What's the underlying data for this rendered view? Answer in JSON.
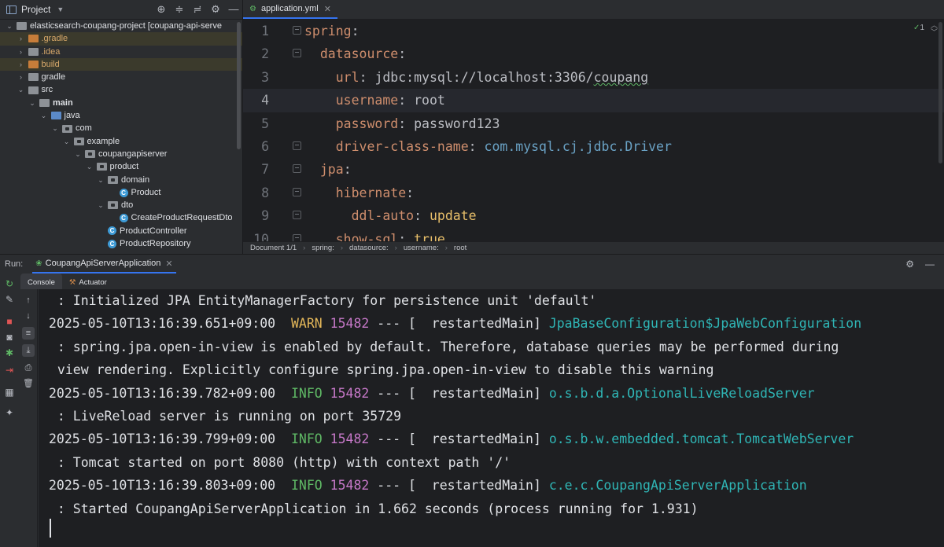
{
  "project": {
    "title": "Project",
    "tree": [
      {
        "indent": 0,
        "chev": "⌄",
        "icon": "proj",
        "label": "elasticsearch-coupang-project [coupang-api-serve",
        "bold_part": "",
        "hl": false
      },
      {
        "indent": 1,
        "chev": "›",
        "icon": "orange",
        "label": ".gradle",
        "hl": true,
        "orange": true
      },
      {
        "indent": 1,
        "chev": "›",
        "icon": "gray",
        "label": ".idea",
        "hl": false,
        "orange": true
      },
      {
        "indent": 1,
        "chev": "›",
        "icon": "orange",
        "label": "build",
        "hl": true,
        "orange": true
      },
      {
        "indent": 1,
        "chev": "›",
        "icon": "gray",
        "label": "gradle",
        "hl": false
      },
      {
        "indent": 1,
        "chev": "⌄",
        "icon": "gray",
        "label": "src",
        "hl": false
      },
      {
        "indent": 2,
        "chev": "⌄",
        "icon": "gray",
        "label": "main",
        "hl": false,
        "bold": true
      },
      {
        "indent": 3,
        "chev": "⌄",
        "icon": "blue",
        "label": "java",
        "hl": false
      },
      {
        "indent": 4,
        "chev": "⌄",
        "icon": "pkg",
        "label": "com",
        "hl": false
      },
      {
        "indent": 5,
        "chev": "⌄",
        "icon": "pkg",
        "label": "example",
        "hl": false
      },
      {
        "indent": 6,
        "chev": "⌄",
        "icon": "pkg",
        "label": "coupangapiserver",
        "hl": false
      },
      {
        "indent": 7,
        "chev": "⌄",
        "icon": "pkg",
        "label": "product",
        "hl": false
      },
      {
        "indent": 8,
        "chev": "⌄",
        "icon": "pkg",
        "label": "domain",
        "hl": false
      },
      {
        "indent": 9,
        "chev": "",
        "icon": "class",
        "label": "Product",
        "hl": false
      },
      {
        "indent": 8,
        "chev": "⌄",
        "icon": "pkg",
        "label": "dto",
        "hl": false
      },
      {
        "indent": 9,
        "chev": "",
        "icon": "class",
        "label": "CreateProductRequestDto",
        "hl": false
      },
      {
        "indent": 8,
        "chev": "",
        "icon": "class",
        "label": "ProductController",
        "hl": false
      },
      {
        "indent": 8,
        "chev": "",
        "icon": "class",
        "label": "ProductRepository",
        "hl": false
      }
    ]
  },
  "editor": {
    "tab_label": "application.yml",
    "status": "1",
    "lines": [
      {
        "n": "1",
        "indent": "",
        "key": "spring",
        "value": "",
        "vclass": "",
        "fold": true,
        "current": false
      },
      {
        "n": "2",
        "indent": "  ",
        "key": "datasource",
        "value": "",
        "vclass": "",
        "fold": true,
        "current": false
      },
      {
        "n": "3",
        "indent": "    ",
        "key": "url",
        "value": "jdbc:mysql://localhost:3306/coupang",
        "vclass": "v",
        "squig": "coupang",
        "fold": false,
        "current": false
      },
      {
        "n": "4",
        "indent": "    ",
        "key": "username",
        "value": "root",
        "vclass": "v",
        "fold": false,
        "current": true
      },
      {
        "n": "5",
        "indent": "    ",
        "key": "password",
        "value": "password123",
        "vclass": "v",
        "fold": false,
        "current": false
      },
      {
        "n": "6",
        "indent": "    ",
        "key": "driver-class-name",
        "value": "com.mysql.cj.jdbc.Driver",
        "vclass": "vc",
        "fold": true,
        "current": false
      },
      {
        "n": "7",
        "indent": "  ",
        "key": "jpa",
        "value": "",
        "vclass": "",
        "fold": true,
        "current": false
      },
      {
        "n": "8",
        "indent": "    ",
        "key": "hibernate",
        "value": "",
        "vclass": "",
        "fold": true,
        "current": false
      },
      {
        "n": "9",
        "indent": "      ",
        "key": "ddl-auto",
        "value": "update",
        "vclass": "vy",
        "fold": true,
        "current": false
      },
      {
        "n": "10",
        "indent": "    ",
        "key": "show-sql",
        "value": "true",
        "vclass": "vy",
        "fold": true,
        "current": false
      }
    ],
    "breadcrumb": [
      "Document 1/1",
      "spring:",
      "datasource:",
      "username:",
      "root"
    ]
  },
  "run": {
    "label": "Run:",
    "tab_label": "CoupangApiServerApplication",
    "subtabs": {
      "console": "Console",
      "actuator": "Actuator"
    },
    "console_lines": [
      {
        "kind": "msg",
        "text": " : Initialized JPA EntityManagerFactory for persistence unit 'default'"
      },
      {
        "kind": "log",
        "ts": "2025-05-10T13:16:39.651+09:00",
        "level": "WARN",
        "pid": "15482",
        "mid": " --- [  restartedMain] ",
        "logger": "JpaBaseConfiguration$JpaWebConfiguration"
      },
      {
        "kind": "msg",
        "text": " : spring.jpa.open-in-view is enabled by default. Therefore, database queries may be performed during"
      },
      {
        "kind": "msg",
        "text": " view rendering. Explicitly configure spring.jpa.open-in-view to disable this warning"
      },
      {
        "kind": "log",
        "ts": "2025-05-10T13:16:39.782+09:00",
        "level": "INFO",
        "pid": "15482",
        "mid": " --- [  restartedMain] ",
        "logger": "o.s.b.d.a.OptionalLiveReloadServer"
      },
      {
        "kind": "msg",
        "text": " : LiveReload server is running on port 35729"
      },
      {
        "kind": "log",
        "ts": "2025-05-10T13:16:39.799+09:00",
        "level": "INFO",
        "pid": "15482",
        "mid": " --- [  restartedMain] ",
        "logger": "o.s.b.w.embedded.tomcat.TomcatWebServer"
      },
      {
        "kind": "msg",
        "text": " : Tomcat started on port 8080 (http) with context path '/'"
      },
      {
        "kind": "log",
        "ts": "2025-05-10T13:16:39.803+09:00",
        "level": "INFO",
        "pid": "15482",
        "mid": " --- [  restartedMain] ",
        "logger": "c.e.c.CoupangApiServerApplication"
      },
      {
        "kind": "msg",
        "text": " : Started CoupangApiServerApplication in 1.662 seconds (process running for 1.931)"
      }
    ]
  },
  "icons": {
    "project_tools": [
      "crosshair-icon",
      "collapse-icon",
      "expand-icon",
      "gear-icon",
      "minimize-icon"
    ],
    "run_tools": [
      "gear-icon",
      "minimize-icon"
    ]
  },
  "colors": {
    "accent": "#3574f0",
    "warn": "#e2b659",
    "info": "#5fb865",
    "pid": "#c678c8",
    "logger": "#2fb5b5",
    "yaml_key": "#cf8e6d"
  }
}
